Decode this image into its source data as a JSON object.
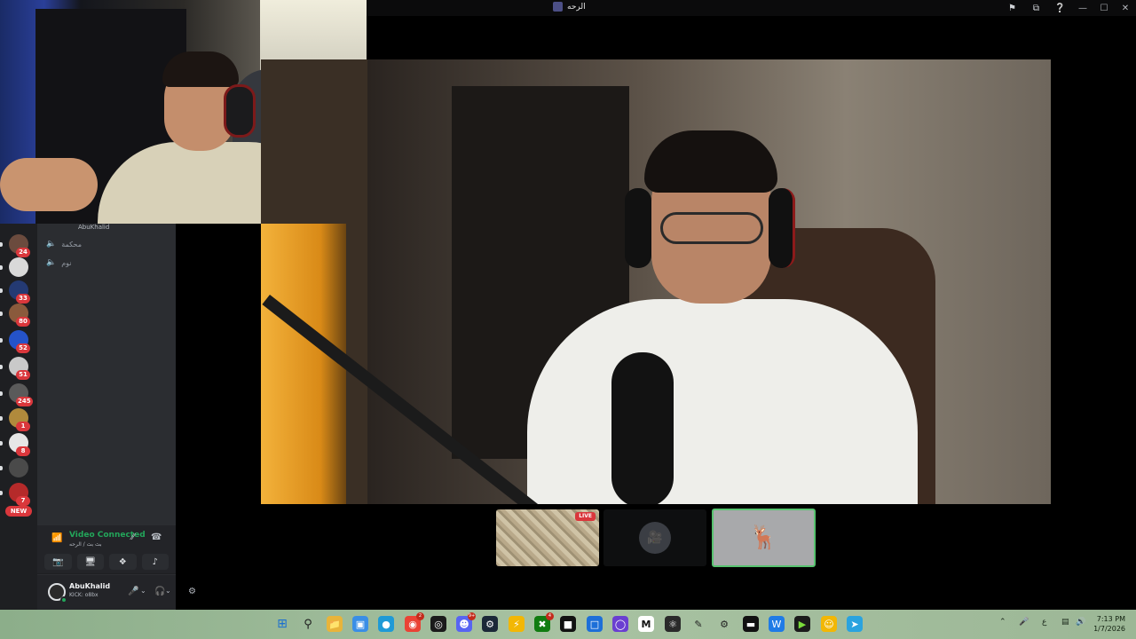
{
  "window": {
    "title": "الرحه"
  },
  "servers": [
    {
      "badge": "24",
      "color": "#6b4b3e"
    },
    {
      "badge": "",
      "color": "#d9d9d9"
    },
    {
      "badge": "33",
      "color": "#243a73"
    },
    {
      "badge": "80",
      "color": "#8a5a3c"
    },
    {
      "badge": "52",
      "color": "#2553c9"
    },
    {
      "badge": "51",
      "color": "#c9c9c9"
    },
    {
      "badge": "245",
      "color": "#5a5a5a"
    },
    {
      "badge": "1",
      "color": "#b08a3c"
    },
    {
      "badge": "8",
      "color": "#e6e6e6"
    },
    {
      "badge": "",
      "color": "#4a4a4a"
    },
    {
      "badge": "7",
      "color": "#b52a2a"
    }
  ],
  "new_badge": "NEW",
  "channels": {
    "connected_user": "AbuKhalid",
    "items": [
      {
        "label": "محكمة"
      },
      {
        "label": "نوم"
      }
    ]
  },
  "rtc": {
    "status": "Video Connected",
    "location": "بث بث / الرحه"
  },
  "user": {
    "name": "AbuKhalid",
    "subtext": "KICK: o8bx"
  },
  "thumbnails": {
    "live_label": "LIVE"
  },
  "clock": {
    "time": "7:13 PM",
    "date": "1/7/2026"
  },
  "taskbar": {
    "badges": {
      "chrome": "2",
      "discord": "9+",
      "xbox": "4"
    },
    "tray_lang": "ع"
  },
  "colors": {
    "accent_green": "#23a55a",
    "danger_red": "#da373c"
  }
}
